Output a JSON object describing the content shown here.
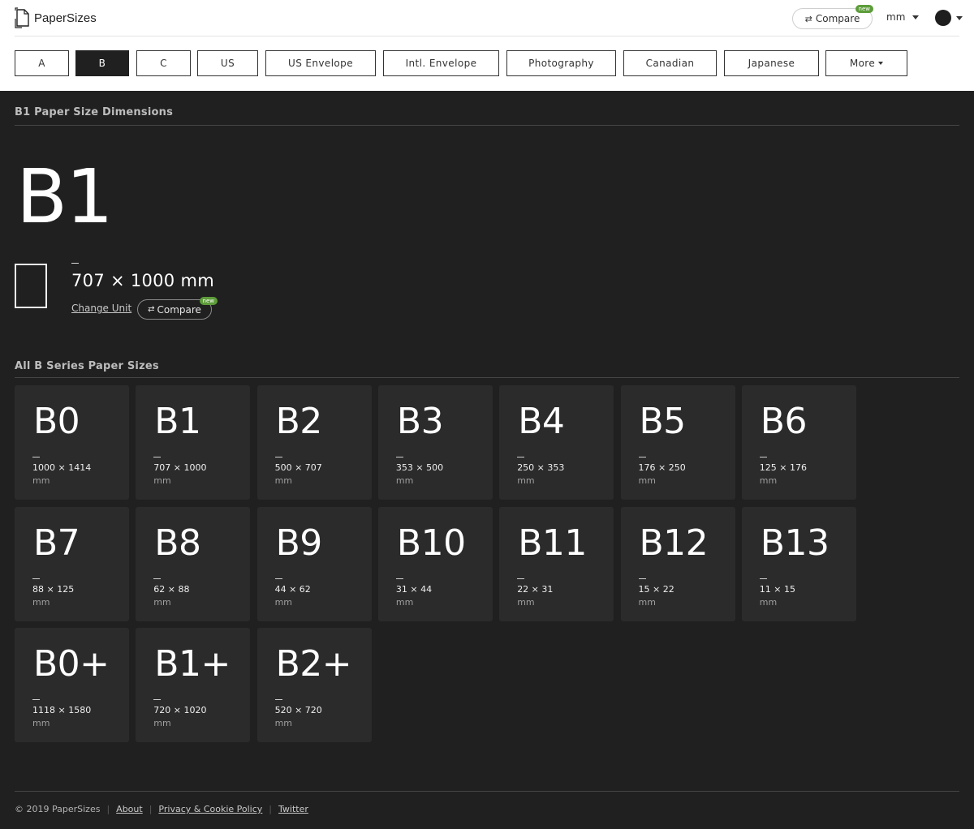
{
  "header": {
    "brand_name": "PaperSizes",
    "compare_label": "Compare",
    "compare_badge": "new",
    "unit": "mm",
    "logo_icon": "document-corner-arrow-icon",
    "theme_icon": "dark-mode-circle-icon"
  },
  "tabs": [
    {
      "label": "A",
      "active": false
    },
    {
      "label": "B",
      "active": true
    },
    {
      "label": "C",
      "active": false
    },
    {
      "label": "US",
      "active": false
    },
    {
      "label": "US Envelope",
      "active": false
    },
    {
      "label": "Intl. Envelope",
      "active": false
    },
    {
      "label": "Photography",
      "active": false
    },
    {
      "label": "Canadian",
      "active": false
    },
    {
      "label": "Japanese",
      "active": false
    },
    {
      "label": "More",
      "active": false
    }
  ],
  "detail": {
    "heading": "B1 Paper Size Dimensions",
    "name": "B1",
    "dimensions": "707 × 1000 mm",
    "change_unit_label": "Change Unit",
    "compare_label": "Compare",
    "compare_badge": "new"
  },
  "series": {
    "heading": "All B Series Paper Sizes",
    "cards": [
      {
        "name": "B0",
        "dims": "1000 × 1414",
        "unit": "mm"
      },
      {
        "name": "B1",
        "dims": "707 × 1000",
        "unit": "mm"
      },
      {
        "name": "B2",
        "dims": "500 × 707",
        "unit": "mm"
      },
      {
        "name": "B3",
        "dims": "353 × 500",
        "unit": "mm"
      },
      {
        "name": "B4",
        "dims": "250 × 353",
        "unit": "mm"
      },
      {
        "name": "B5",
        "dims": "176 × 250",
        "unit": "mm"
      },
      {
        "name": "B6",
        "dims": "125 × 176",
        "unit": "mm"
      },
      {
        "name": "B7",
        "dims": "88 × 125",
        "unit": "mm"
      },
      {
        "name": "B8",
        "dims": "62 × 88",
        "unit": "mm"
      },
      {
        "name": "B9",
        "dims": "44 × 62",
        "unit": "mm"
      },
      {
        "name": "B10",
        "dims": "31 × 44",
        "unit": "mm"
      },
      {
        "name": "B11",
        "dims": "22 × 31",
        "unit": "mm"
      },
      {
        "name": "B12",
        "dims": "15 × 22",
        "unit": "mm"
      },
      {
        "name": "B13",
        "dims": "11 × 15",
        "unit": "mm"
      },
      {
        "name": "B0+",
        "dims": "1118 × 1580",
        "unit": "mm"
      },
      {
        "name": "B1+",
        "dims": "720 × 1020",
        "unit": "mm"
      },
      {
        "name": "B2+",
        "dims": "520 × 720",
        "unit": "mm"
      }
    ]
  },
  "footer": {
    "copyright": "© 2019 PaperSizes",
    "links": [
      "About",
      "Privacy & Cookie Policy",
      "Twitter"
    ]
  },
  "colors": {
    "background": "#202020",
    "card": "#2b2b2b",
    "badge": "#5d9c3a",
    "header": "#ffffff"
  }
}
